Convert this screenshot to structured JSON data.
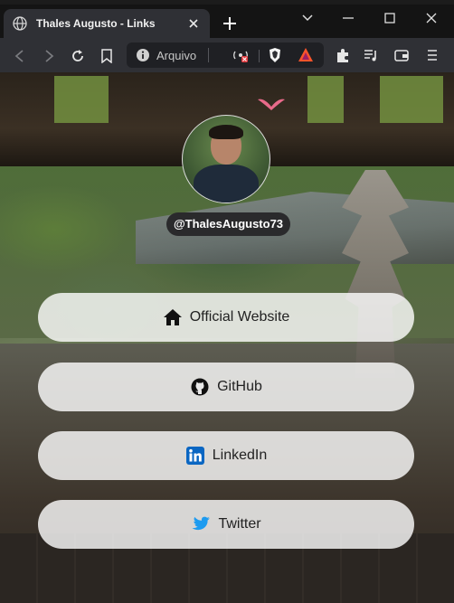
{
  "browser": {
    "tab_title": "Thales Augusto - Links",
    "url_text": "Arquivo"
  },
  "profile": {
    "username": "@ThalesAugusto73"
  },
  "links": [
    {
      "label": "Official Website",
      "icon": "home-icon"
    },
    {
      "label": "GitHub",
      "icon": "github-icon"
    },
    {
      "label": "LinkedIn",
      "icon": "linkedin-icon"
    },
    {
      "label": "Twitter",
      "icon": "twitter-icon"
    }
  ],
  "colors": {
    "linkedin_blue": "#0a66c2",
    "twitter_blue": "#1d9bf0",
    "heart_pink": "#e86a8a",
    "brave_red": "#fb542b"
  }
}
